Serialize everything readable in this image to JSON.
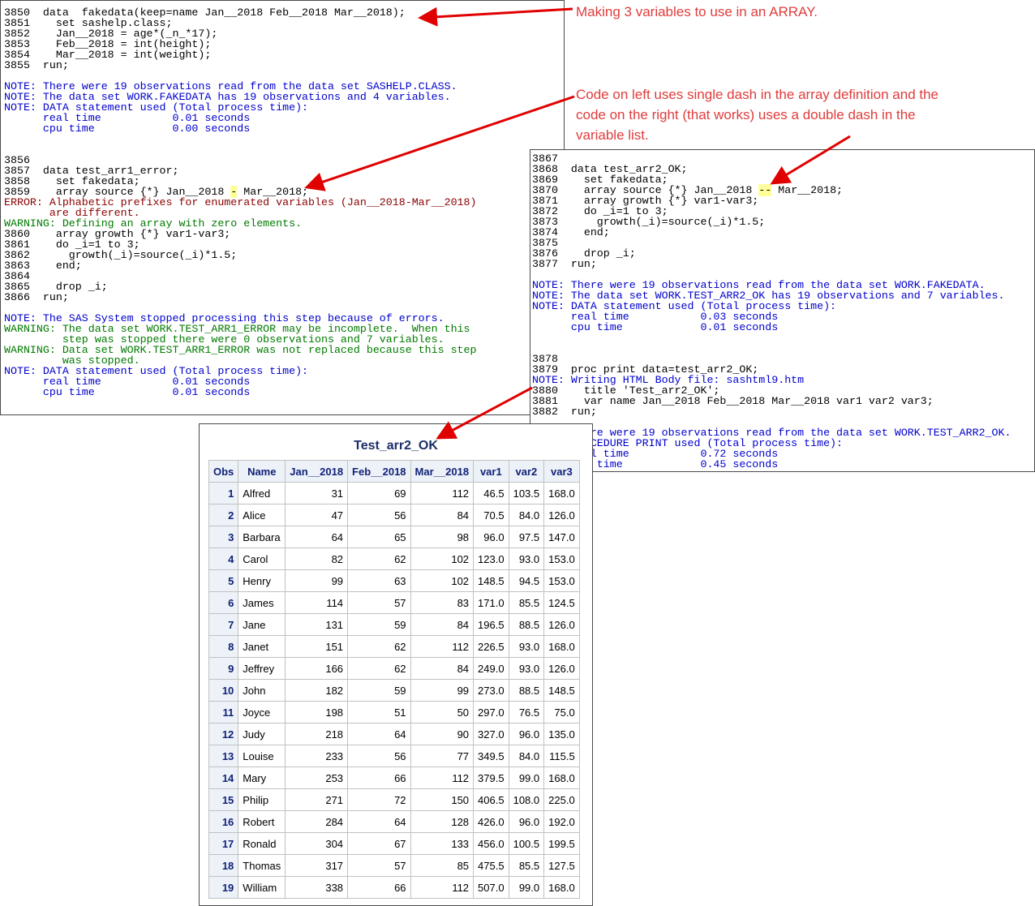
{
  "log_left": {
    "lines": [
      {
        "t": "3850  data  fakedata(keep=name Jan__2018 Feb__2018 Mar__2018);",
        "c": ""
      },
      {
        "t": "3851    set sashelp.class;",
        "c": ""
      },
      {
        "t": "3852    Jan__2018 = age*(_n_*17);",
        "c": ""
      },
      {
        "t": "3853    Feb__2018 = int(height);",
        "c": ""
      },
      {
        "t": "3854    Mar__2018 = int(weight);",
        "c": ""
      },
      {
        "t": "3855  run;",
        "c": ""
      },
      {
        "t": "",
        "c": ""
      },
      {
        "t": "NOTE: There were 19 observations read from the data set SASHELP.CLASS.",
        "c": "note"
      },
      {
        "t": "NOTE: The data set WORK.FAKEDATA has 19 observations and 4 variables.",
        "c": "note"
      },
      {
        "t": "NOTE: DATA statement used (Total process time):",
        "c": "note"
      },
      {
        "t": "      real time           0.01 seconds",
        "c": "note"
      },
      {
        "t": "      cpu time            0.00 seconds",
        "c": "note"
      },
      {
        "t": "",
        "c": ""
      },
      {
        "t": "",
        "c": ""
      },
      {
        "t": "3856",
        "c": ""
      },
      {
        "t": "3857  data test_arr1_error;",
        "c": ""
      },
      {
        "t": "3858    set fakedata;",
        "c": ""
      },
      {
        "t": "3859    array source {*} Jan__2018 - Mar__2018;",
        "c": "",
        "hl": "-"
      },
      {
        "t": "ERROR: Alphabetic prefixes for enumerated variables (Jan__2018-Mar__2018)",
        "c": "err"
      },
      {
        "t": "       are different.",
        "c": "err"
      },
      {
        "t": "WARNING: Defining an array with zero elements.",
        "c": "warn"
      },
      {
        "t": "3860    array growth {*} var1-var3;",
        "c": ""
      },
      {
        "t": "3861    do _i=1 to 3;",
        "c": ""
      },
      {
        "t": "3862      growth(_i)=source(_i)*1.5;",
        "c": ""
      },
      {
        "t": "3863    end;",
        "c": ""
      },
      {
        "t": "3864",
        "c": ""
      },
      {
        "t": "3865    drop _i;",
        "c": ""
      },
      {
        "t": "3866  run;",
        "c": ""
      },
      {
        "t": "",
        "c": ""
      },
      {
        "t": "NOTE: The SAS System stopped processing this step because of errors.",
        "c": "note"
      },
      {
        "t": "WARNING: The data set WORK.TEST_ARR1_ERROR may be incomplete.  When this",
        "c": "warn"
      },
      {
        "t": "         step was stopped there were 0 observations and 7 variables.",
        "c": "warn"
      },
      {
        "t": "WARNING: Data set WORK.TEST_ARR1_ERROR was not replaced because this step",
        "c": "warn"
      },
      {
        "t": "         was stopped.",
        "c": "warn"
      },
      {
        "t": "NOTE: DATA statement used (Total process time):",
        "c": "note"
      },
      {
        "t": "      real time           0.01 seconds",
        "c": "note"
      },
      {
        "t": "      cpu time            0.01 seconds",
        "c": "note"
      }
    ]
  },
  "log_right": {
    "lines": [
      {
        "t": "3867",
        "c": ""
      },
      {
        "t": "3868  data test_arr2_OK;",
        "c": ""
      },
      {
        "t": "3869    set fakedata;",
        "c": ""
      },
      {
        "t": "3870    array source {*} Jan__2018 -- Mar__2018;",
        "c": "",
        "hl": "--"
      },
      {
        "t": "3871    array growth {*} var1-var3;",
        "c": ""
      },
      {
        "t": "3872    do _i=1 to 3;",
        "c": ""
      },
      {
        "t": "3873      growth(_i)=source(_i)*1.5;",
        "c": ""
      },
      {
        "t": "3874    end;",
        "c": ""
      },
      {
        "t": "3875",
        "c": ""
      },
      {
        "t": "3876    drop _i;",
        "c": ""
      },
      {
        "t": "3877  run;",
        "c": ""
      },
      {
        "t": "",
        "c": ""
      },
      {
        "t": "NOTE: There were 19 observations read from the data set WORK.FAKEDATA.",
        "c": "note"
      },
      {
        "t": "NOTE: The data set WORK.TEST_ARR2_OK has 19 observations and 7 variables.",
        "c": "note"
      },
      {
        "t": "NOTE: DATA statement used (Total process time):",
        "c": "note"
      },
      {
        "t": "      real time           0.03 seconds",
        "c": "note"
      },
      {
        "t": "      cpu time            0.01 seconds",
        "c": "note"
      },
      {
        "t": "",
        "c": ""
      },
      {
        "t": "",
        "c": ""
      },
      {
        "t": "3878",
        "c": ""
      },
      {
        "t": "3879  proc print data=test_arr2_OK;",
        "c": ""
      },
      {
        "t": "NOTE: Writing HTML Body file: sashtml9.htm",
        "c": "note"
      },
      {
        "t": "3880    title 'Test_arr2_OK';",
        "c": ""
      },
      {
        "t": "3881    var name Jan__2018 Feb__2018 Mar__2018 var1 var2 var3;",
        "c": ""
      },
      {
        "t": "3882  run;",
        "c": ""
      },
      {
        "t": "",
        "c": ""
      },
      {
        "t": "NOTE: There were 19 observations read from the data set WORK.TEST_ARR2_OK.",
        "c": "note"
      },
      {
        "t": "NOTE: PROCEDURE PRINT used (Total process time):",
        "c": "note"
      },
      {
        "t": "      real time           0.72 seconds",
        "c": "note"
      },
      {
        "t": "      cpu time            0.45 seconds",
        "c": "note"
      }
    ]
  },
  "callouts": {
    "top": "Making 3 variables to use in an ARRAY.",
    "middle_l1": "Code on left uses single dash in  the array definition and the",
    "middle_l2": "code on the right (that works) uses a double dash in the",
    "middle_l3": "variable list."
  },
  "report": {
    "title": "Test_arr2_OK",
    "headers": [
      "Obs",
      "Name",
      "Jan__2018",
      "Feb__2018",
      "Mar__2018",
      "var1",
      "var2",
      "var3"
    ],
    "rows": [
      [
        "1",
        "Alfred",
        "31",
        "69",
        "112",
        "46.5",
        "103.5",
        "168.0"
      ],
      [
        "2",
        "Alice",
        "47",
        "56",
        "84",
        "70.5",
        "84.0",
        "126.0"
      ],
      [
        "3",
        "Barbara",
        "64",
        "65",
        "98",
        "96.0",
        "97.5",
        "147.0"
      ],
      [
        "4",
        "Carol",
        "82",
        "62",
        "102",
        "123.0",
        "93.0",
        "153.0"
      ],
      [
        "5",
        "Henry",
        "99",
        "63",
        "102",
        "148.5",
        "94.5",
        "153.0"
      ],
      [
        "6",
        "James",
        "114",
        "57",
        "83",
        "171.0",
        "85.5",
        "124.5"
      ],
      [
        "7",
        "Jane",
        "131",
        "59",
        "84",
        "196.5",
        "88.5",
        "126.0"
      ],
      [
        "8",
        "Janet",
        "151",
        "62",
        "112",
        "226.5",
        "93.0",
        "168.0"
      ],
      [
        "9",
        "Jeffrey",
        "166",
        "62",
        "84",
        "249.0",
        "93.0",
        "126.0"
      ],
      [
        "10",
        "John",
        "182",
        "59",
        "99",
        "273.0",
        "88.5",
        "148.5"
      ],
      [
        "11",
        "Joyce",
        "198",
        "51",
        "50",
        "297.0",
        "76.5",
        "75.0"
      ],
      [
        "12",
        "Judy",
        "218",
        "64",
        "90",
        "327.0",
        "96.0",
        "135.0"
      ],
      [
        "13",
        "Louise",
        "233",
        "56",
        "77",
        "349.5",
        "84.0",
        "115.5"
      ],
      [
        "14",
        "Mary",
        "253",
        "66",
        "112",
        "379.5",
        "99.0",
        "168.0"
      ],
      [
        "15",
        "Philip",
        "271",
        "72",
        "150",
        "406.5",
        "108.0",
        "225.0"
      ],
      [
        "16",
        "Robert",
        "284",
        "64",
        "128",
        "426.0",
        "96.0",
        "192.0"
      ],
      [
        "17",
        "Ronald",
        "304",
        "67",
        "133",
        "456.0",
        "100.5",
        "199.5"
      ],
      [
        "18",
        "Thomas",
        "317",
        "57",
        "85",
        "475.5",
        "85.5",
        "127.5"
      ],
      [
        "19",
        "William",
        "338",
        "66",
        "112",
        "507.0",
        "99.0",
        "168.0"
      ]
    ]
  },
  "colors": {
    "note": "#0000cc",
    "error": "#8b0000",
    "warning": "#007a00",
    "callout": "#e03c3c",
    "highlight": "#ffff99",
    "header_bg": "#edf2f9",
    "header_text": "#112277"
  }
}
